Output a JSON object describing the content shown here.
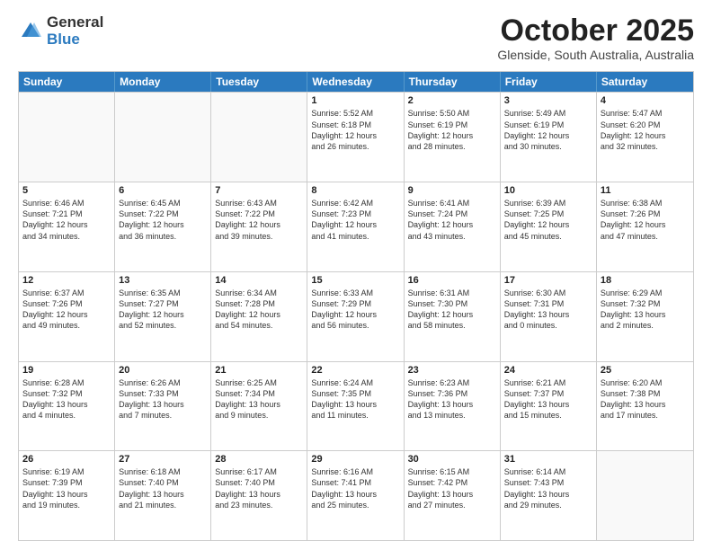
{
  "logo": {
    "general": "General",
    "blue": "Blue"
  },
  "header": {
    "month": "October 2025",
    "location": "Glenside, South Australia, Australia"
  },
  "weekdays": [
    "Sunday",
    "Monday",
    "Tuesday",
    "Wednesday",
    "Thursday",
    "Friday",
    "Saturday"
  ],
  "rows": [
    [
      {
        "day": "",
        "info": ""
      },
      {
        "day": "",
        "info": ""
      },
      {
        "day": "",
        "info": ""
      },
      {
        "day": "1",
        "info": "Sunrise: 5:52 AM\nSunset: 6:18 PM\nDaylight: 12 hours\nand 26 minutes."
      },
      {
        "day": "2",
        "info": "Sunrise: 5:50 AM\nSunset: 6:19 PM\nDaylight: 12 hours\nand 28 minutes."
      },
      {
        "day": "3",
        "info": "Sunrise: 5:49 AM\nSunset: 6:19 PM\nDaylight: 12 hours\nand 30 minutes."
      },
      {
        "day": "4",
        "info": "Sunrise: 5:47 AM\nSunset: 6:20 PM\nDaylight: 12 hours\nand 32 minutes."
      }
    ],
    [
      {
        "day": "5",
        "info": "Sunrise: 6:46 AM\nSunset: 7:21 PM\nDaylight: 12 hours\nand 34 minutes."
      },
      {
        "day": "6",
        "info": "Sunrise: 6:45 AM\nSunset: 7:22 PM\nDaylight: 12 hours\nand 36 minutes."
      },
      {
        "day": "7",
        "info": "Sunrise: 6:43 AM\nSunset: 7:22 PM\nDaylight: 12 hours\nand 39 minutes."
      },
      {
        "day": "8",
        "info": "Sunrise: 6:42 AM\nSunset: 7:23 PM\nDaylight: 12 hours\nand 41 minutes."
      },
      {
        "day": "9",
        "info": "Sunrise: 6:41 AM\nSunset: 7:24 PM\nDaylight: 12 hours\nand 43 minutes."
      },
      {
        "day": "10",
        "info": "Sunrise: 6:39 AM\nSunset: 7:25 PM\nDaylight: 12 hours\nand 45 minutes."
      },
      {
        "day": "11",
        "info": "Sunrise: 6:38 AM\nSunset: 7:26 PM\nDaylight: 12 hours\nand 47 minutes."
      }
    ],
    [
      {
        "day": "12",
        "info": "Sunrise: 6:37 AM\nSunset: 7:26 PM\nDaylight: 12 hours\nand 49 minutes."
      },
      {
        "day": "13",
        "info": "Sunrise: 6:35 AM\nSunset: 7:27 PM\nDaylight: 12 hours\nand 52 minutes."
      },
      {
        "day": "14",
        "info": "Sunrise: 6:34 AM\nSunset: 7:28 PM\nDaylight: 12 hours\nand 54 minutes."
      },
      {
        "day": "15",
        "info": "Sunrise: 6:33 AM\nSunset: 7:29 PM\nDaylight: 12 hours\nand 56 minutes."
      },
      {
        "day": "16",
        "info": "Sunrise: 6:31 AM\nSunset: 7:30 PM\nDaylight: 12 hours\nand 58 minutes."
      },
      {
        "day": "17",
        "info": "Sunrise: 6:30 AM\nSunset: 7:31 PM\nDaylight: 13 hours\nand 0 minutes."
      },
      {
        "day": "18",
        "info": "Sunrise: 6:29 AM\nSunset: 7:32 PM\nDaylight: 13 hours\nand 2 minutes."
      }
    ],
    [
      {
        "day": "19",
        "info": "Sunrise: 6:28 AM\nSunset: 7:32 PM\nDaylight: 13 hours\nand 4 minutes."
      },
      {
        "day": "20",
        "info": "Sunrise: 6:26 AM\nSunset: 7:33 PM\nDaylight: 13 hours\nand 7 minutes."
      },
      {
        "day": "21",
        "info": "Sunrise: 6:25 AM\nSunset: 7:34 PM\nDaylight: 13 hours\nand 9 minutes."
      },
      {
        "day": "22",
        "info": "Sunrise: 6:24 AM\nSunset: 7:35 PM\nDaylight: 13 hours\nand 11 minutes."
      },
      {
        "day": "23",
        "info": "Sunrise: 6:23 AM\nSunset: 7:36 PM\nDaylight: 13 hours\nand 13 minutes."
      },
      {
        "day": "24",
        "info": "Sunrise: 6:21 AM\nSunset: 7:37 PM\nDaylight: 13 hours\nand 15 minutes."
      },
      {
        "day": "25",
        "info": "Sunrise: 6:20 AM\nSunset: 7:38 PM\nDaylight: 13 hours\nand 17 minutes."
      }
    ],
    [
      {
        "day": "26",
        "info": "Sunrise: 6:19 AM\nSunset: 7:39 PM\nDaylight: 13 hours\nand 19 minutes."
      },
      {
        "day": "27",
        "info": "Sunrise: 6:18 AM\nSunset: 7:40 PM\nDaylight: 13 hours\nand 21 minutes."
      },
      {
        "day": "28",
        "info": "Sunrise: 6:17 AM\nSunset: 7:40 PM\nDaylight: 13 hours\nand 23 minutes."
      },
      {
        "day": "29",
        "info": "Sunrise: 6:16 AM\nSunset: 7:41 PM\nDaylight: 13 hours\nand 25 minutes."
      },
      {
        "day": "30",
        "info": "Sunrise: 6:15 AM\nSunset: 7:42 PM\nDaylight: 13 hours\nand 27 minutes."
      },
      {
        "day": "31",
        "info": "Sunrise: 6:14 AM\nSunset: 7:43 PM\nDaylight: 13 hours\nand 29 minutes."
      },
      {
        "day": "",
        "info": ""
      }
    ]
  ]
}
